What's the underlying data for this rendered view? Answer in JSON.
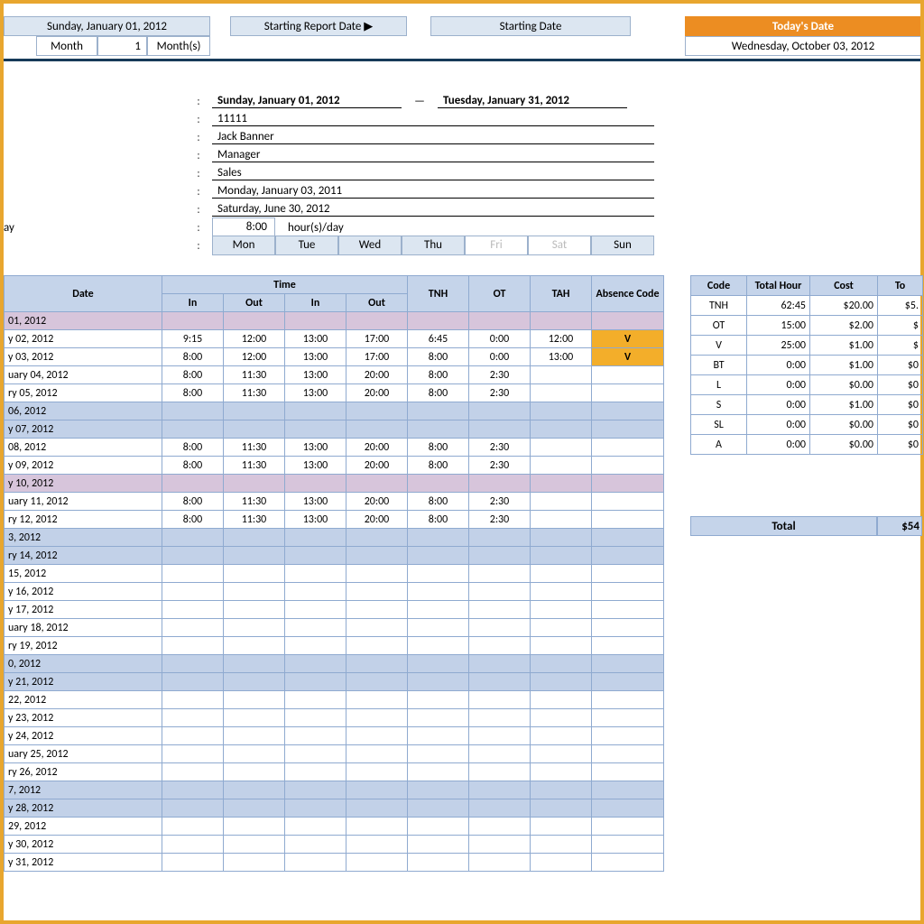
{
  "top": {
    "report_date_cell": "Sunday, January 01, 2012",
    "start_label": "Starting Report Date ▶",
    "starting_date_label": "Starting Date",
    "todays_date_label": "Today's Date",
    "todays_date_value": "Wednesday, October 03, 2012",
    "month_label": "Month",
    "month_value": "1",
    "months_label": "Month(s)"
  },
  "info": {
    "period_from": "Sunday, January 01, 2012",
    "period_to": "Tuesday, January 31, 2012",
    "emp_id": "11111",
    "name": "Jack Banner",
    "title": "Manager",
    "dept": "Sales",
    "hire_date": "Monday, January 03, 2011",
    "end_date": "Saturday, June 30, 2012",
    "hours_val": "8:00",
    "hours_unit": "hour(s)/day",
    "dow": [
      "Mon",
      "Tue",
      "Wed",
      "Thu",
      "Fri",
      "Sat",
      "Sun"
    ]
  },
  "hdr": {
    "date": "Date",
    "time": "Time",
    "in": "In",
    "out": "Out",
    "tnh": "TNH",
    "ot": "OT",
    "tah": "TAH",
    "abs": "Absence Code",
    "code": "Code",
    "th": "Total Hour",
    "cost": "Cost",
    "tot": "To",
    "total_label": "Total",
    "total_val": "$54"
  },
  "rows": [
    {
      "d": "01, 2012",
      "cls": "row-pink"
    },
    {
      "d": "y 02, 2012",
      "in1": "9:15",
      "out1": "12:00",
      "in2": "13:00",
      "out2": "17:00",
      "tnh": "6:45",
      "ot": "0:00",
      "tah": "12:00",
      "abs": "V"
    },
    {
      "d": "y 03, 2012",
      "in1": "8:00",
      "out1": "12:00",
      "in2": "13:00",
      "out2": "17:00",
      "tnh": "8:00",
      "ot": "0:00",
      "tah": "13:00",
      "abs": "V"
    },
    {
      "d": "uary 04, 2012",
      "in1": "8:00",
      "out1": "11:30",
      "in2": "13:00",
      "out2": "20:00",
      "tnh": "8:00",
      "ot": "2:30"
    },
    {
      "d": "ry 05, 2012",
      "in1": "8:00",
      "out1": "11:30",
      "in2": "13:00",
      "out2": "20:00",
      "tnh": "8:00",
      "ot": "2:30"
    },
    {
      "d": "06, 2012",
      "cls": "row-blue"
    },
    {
      "d": "y 07, 2012",
      "cls": "row-blue"
    },
    {
      "d": "08, 2012",
      "in1": "8:00",
      "out1": "11:30",
      "in2": "13:00",
      "out2": "20:00",
      "tnh": "8:00",
      "ot": "2:30"
    },
    {
      "d": "y 09, 2012",
      "in1": "8:00",
      "out1": "11:30",
      "in2": "13:00",
      "out2": "20:00",
      "tnh": "8:00",
      "ot": "2:30"
    },
    {
      "d": "y 10, 2012",
      "cls": "row-pink"
    },
    {
      "d": "uary 11, 2012",
      "in1": "8:00",
      "out1": "11:30",
      "in2": "13:00",
      "out2": "20:00",
      "tnh": "8:00",
      "ot": "2:30"
    },
    {
      "d": "ry 12, 2012",
      "in1": "8:00",
      "out1": "11:30",
      "in2": "13:00",
      "out2": "20:00",
      "tnh": "8:00",
      "ot": "2:30"
    },
    {
      "d": "3, 2012",
      "cls": "row-blue"
    },
    {
      "d": "ry 14, 2012",
      "cls": "row-blue"
    },
    {
      "d": "15, 2012"
    },
    {
      "d": "y 16, 2012"
    },
    {
      "d": "y 17, 2012"
    },
    {
      "d": "uary 18, 2012"
    },
    {
      "d": "ry 19, 2012"
    },
    {
      "d": "0, 2012",
      "cls": "row-blue"
    },
    {
      "d": "y 21, 2012",
      "cls": "row-blue"
    },
    {
      "d": "22, 2012"
    },
    {
      "d": "y 23, 2012"
    },
    {
      "d": "y 24, 2012"
    },
    {
      "d": "uary 25, 2012"
    },
    {
      "d": "ry 26, 2012"
    },
    {
      "d": "7, 2012",
      "cls": "row-blue"
    },
    {
      "d": "y 28, 2012",
      "cls": "row-blue"
    },
    {
      "d": "29, 2012"
    },
    {
      "d": "y 30, 2012"
    },
    {
      "d": "y 31, 2012"
    }
  ],
  "summary": [
    {
      "code": "TNH",
      "th": "62:45",
      "cost": "$20.00",
      "tot": "$5."
    },
    {
      "code": "OT",
      "th": "15:00",
      "cost": "$2.00",
      "tot": "$"
    },
    {
      "code": "V",
      "th": "25:00",
      "cost": "$1.00",
      "tot": "$"
    },
    {
      "code": "BT",
      "th": "0:00",
      "cost": "$1.00",
      "tot": "$0"
    },
    {
      "code": "L",
      "th": "0:00",
      "cost": "$0.00",
      "tot": "$0"
    },
    {
      "code": "S",
      "th": "0:00",
      "cost": "$1.00",
      "tot": "$0"
    },
    {
      "code": "SL",
      "th": "0:00",
      "cost": "$0.00",
      "tot": "$0"
    },
    {
      "code": "A",
      "th": "0:00",
      "cost": "$0.00",
      "tot": "$0"
    }
  ]
}
